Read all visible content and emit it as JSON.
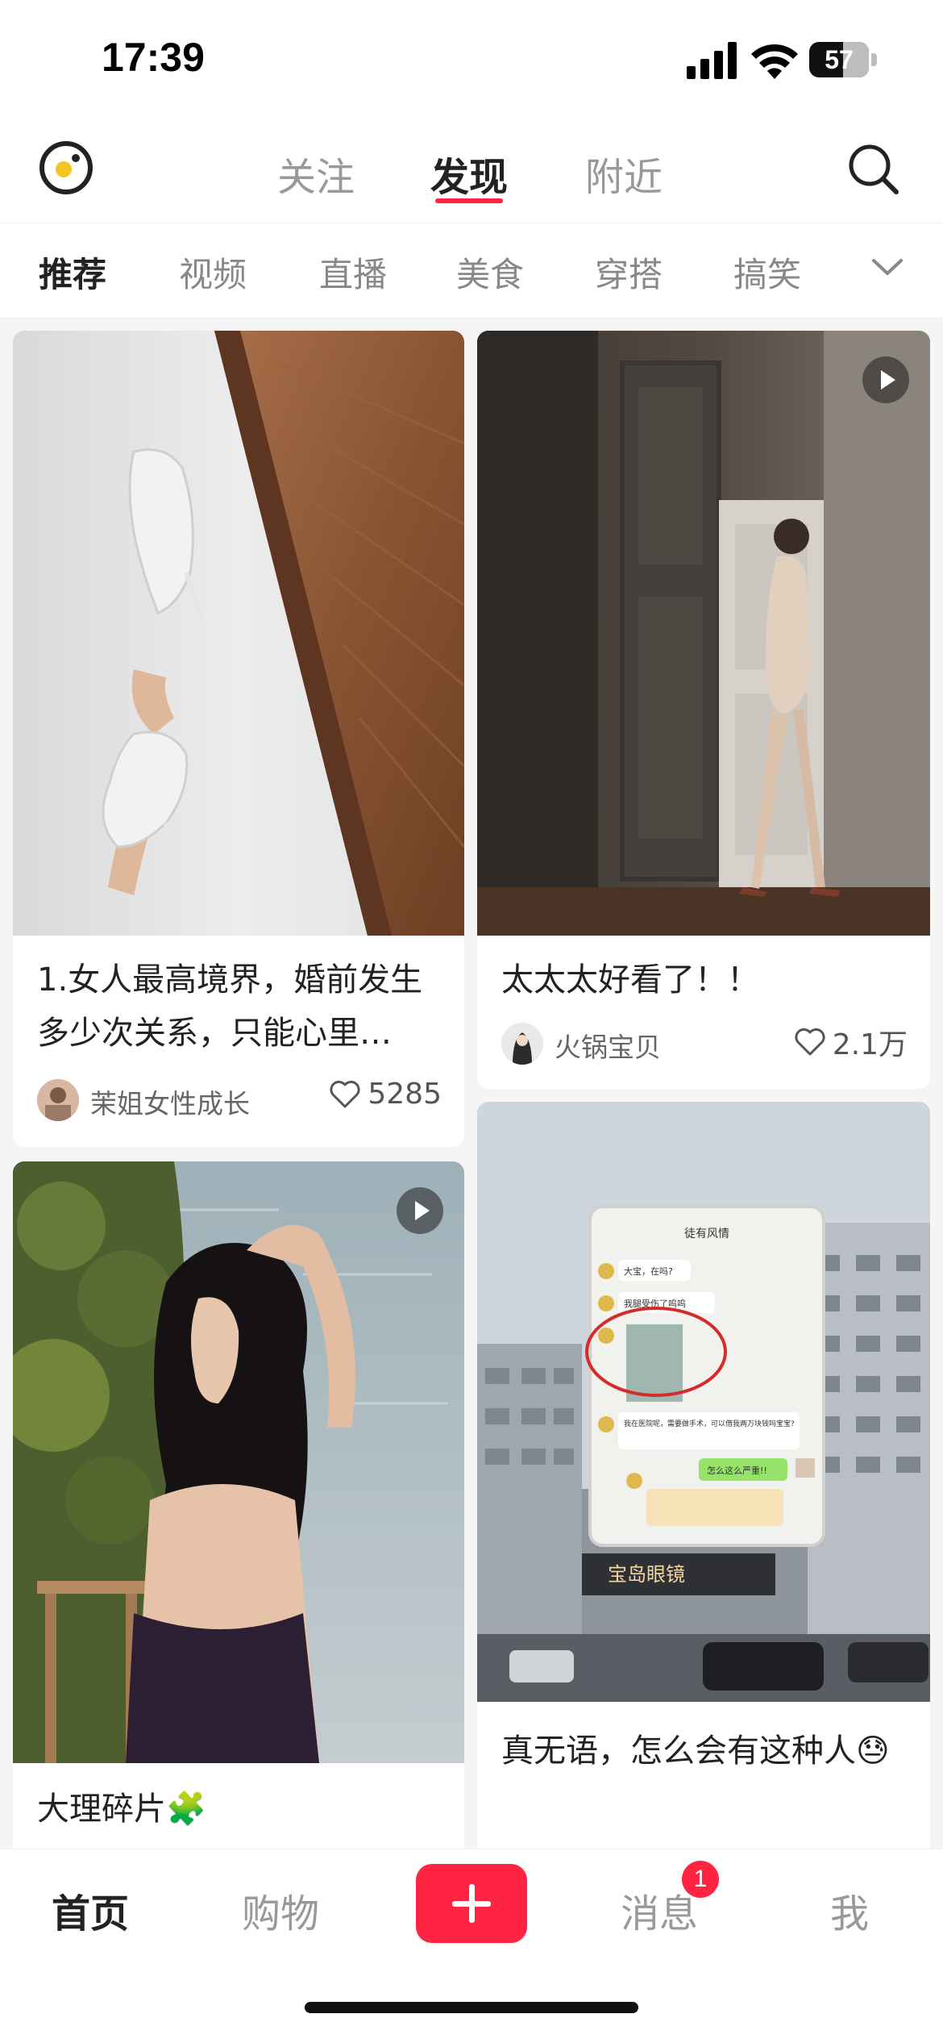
{
  "status_bar": {
    "time": "17:39",
    "battery": "57"
  },
  "top_nav": {
    "tabs": [
      {
        "label": "关注"
      },
      {
        "label": "发现"
      },
      {
        "label": "附近"
      }
    ],
    "active_tab": "发现"
  },
  "categories": {
    "items": [
      {
        "label": "推荐"
      },
      {
        "label": "视频"
      },
      {
        "label": "直播"
      },
      {
        "label": "美食"
      },
      {
        "label": "穿搭"
      },
      {
        "label": "搞笑"
      }
    ],
    "active": "推荐"
  },
  "feed": {
    "cards": [
      {
        "title": "1.女人最高境界，婚前发生多少次关系，只能心里…",
        "author": "茉姐女性成长",
        "likes": "5285",
        "is_video": false
      },
      {
        "title": "太太太好看了！！",
        "author": "火锅宝贝",
        "likes": "2.1万",
        "is_video": true
      },
      {
        "title": "大理碎片🧩",
        "is_video": true
      },
      {
        "title": "真无语，怎么会有这种人😓",
        "is_video": false,
        "image_text": {
          "chat_title": "徒有风情",
          "bubble_1": "大宝，在吗?",
          "bubble_2": "我腿受伤了呜呜",
          "bubble_3": "我在医院呢，需要做手术，可以借我两万块钱吗宝宝?",
          "reply": "怎么这么严重!!",
          "shop_sign": "宝岛眼镜"
        }
      }
    ]
  },
  "bottom_tabs": [
    {
      "label": "首页"
    },
    {
      "label": "购物"
    },
    {
      "label": "消息"
    },
    {
      "label": "我"
    }
  ],
  "messages_badge": "1",
  "colors": {
    "accent": "#ff2442"
  }
}
